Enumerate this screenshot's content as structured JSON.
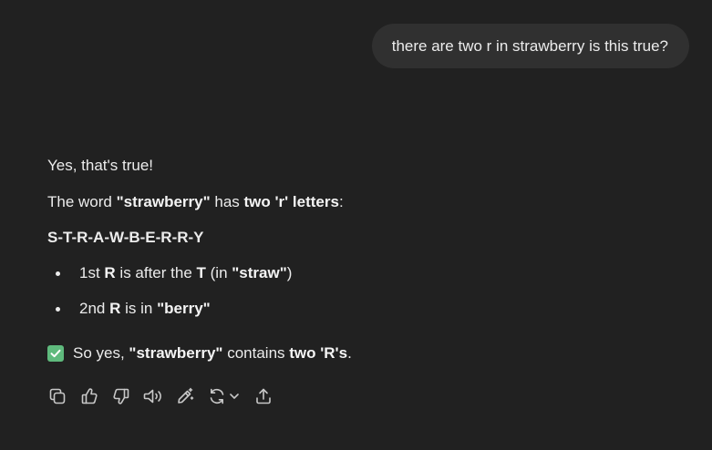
{
  "user_message": "there are two r in strawberry is this true?",
  "assistant": {
    "p1": "Yes, that's true!",
    "p2": {
      "t1": "The word ",
      "b1": "\"strawberry\"",
      "t2": " has ",
      "b2": "two 'r' letters",
      "t3": ":"
    },
    "spelling": "S-T-R-A-W-B-E-R-R-Y",
    "bullets": [
      {
        "t1": "1st ",
        "b1": "R",
        "t2": " is after the ",
        "b2": "T",
        "t3": " (in ",
        "b3": "\"straw\"",
        "t4": ")"
      },
      {
        "t1": "2nd ",
        "b1": "R",
        "t2": " is in ",
        "b2": "\"berry\""
      }
    ],
    "conclusion": {
      "t1": "So yes, ",
      "b1": "\"strawberry\"",
      "t2": " contains ",
      "b2": "two 'R's",
      "t3": "."
    }
  },
  "toolbar_icons": [
    "copy-icon",
    "thumbs-up-icon",
    "thumbs-down-icon",
    "read-aloud-icon",
    "edit-magic-icon",
    "regenerate-icon",
    "share-icon"
  ],
  "colors": {
    "background": "#212121",
    "bubble": "#303030",
    "text": "#ececec",
    "check": "#5fba7d"
  }
}
